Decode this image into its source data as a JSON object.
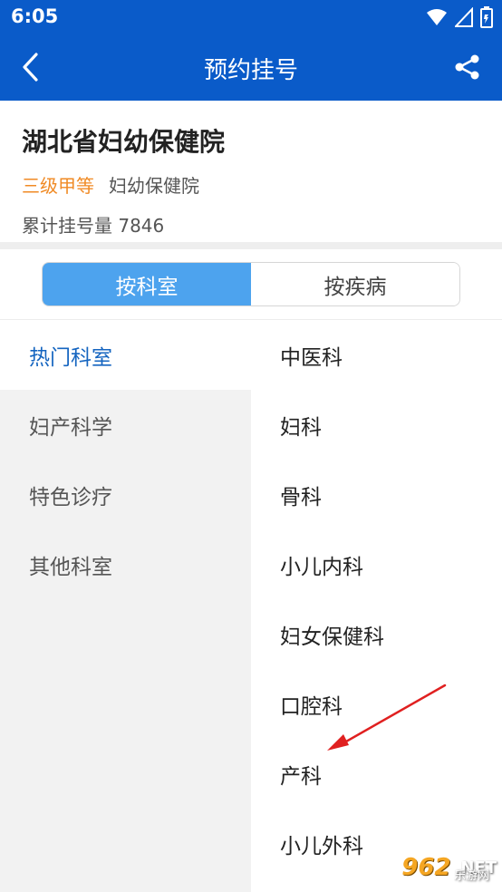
{
  "status_bar": {
    "time": "6:05",
    "icons": [
      "wifi-icon",
      "signal-icon",
      "battery-icon"
    ]
  },
  "app_bar": {
    "title": "预约挂号",
    "back_icon": "back-chevron-icon",
    "share_icon": "share-icon",
    "background_color": "#0a5bc9"
  },
  "hospital": {
    "name": "湖北省妇幼保健院",
    "level": "三级甲等",
    "type": "妇幼保健院",
    "registration_label": "累计挂号量",
    "registration_count": "7846",
    "level_color": "#f08a24"
  },
  "tabs": [
    {
      "label": "按科室",
      "active": true
    },
    {
      "label": "按疾病",
      "active": false
    }
  ],
  "categories": [
    {
      "label": "热门科室",
      "active": true
    },
    {
      "label": "妇产科学",
      "active": false
    },
    {
      "label": "特色诊疗",
      "active": false
    },
    {
      "label": "其他科室",
      "active": false
    }
  ],
  "departments": [
    {
      "label": "中医科"
    },
    {
      "label": "妇科"
    },
    {
      "label": "骨科"
    },
    {
      "label": "小儿内科"
    },
    {
      "label": "妇女保健科"
    },
    {
      "label": "口腔科"
    },
    {
      "label": "产科"
    },
    {
      "label": "小儿外科"
    }
  ],
  "watermark": {
    "badge": "962",
    "suffix": ".NET",
    "sub": "乐游网"
  },
  "colors": {
    "accent": "#4da3ee",
    "active_category": "#1565c0",
    "annotation_arrow": "#e02020"
  }
}
